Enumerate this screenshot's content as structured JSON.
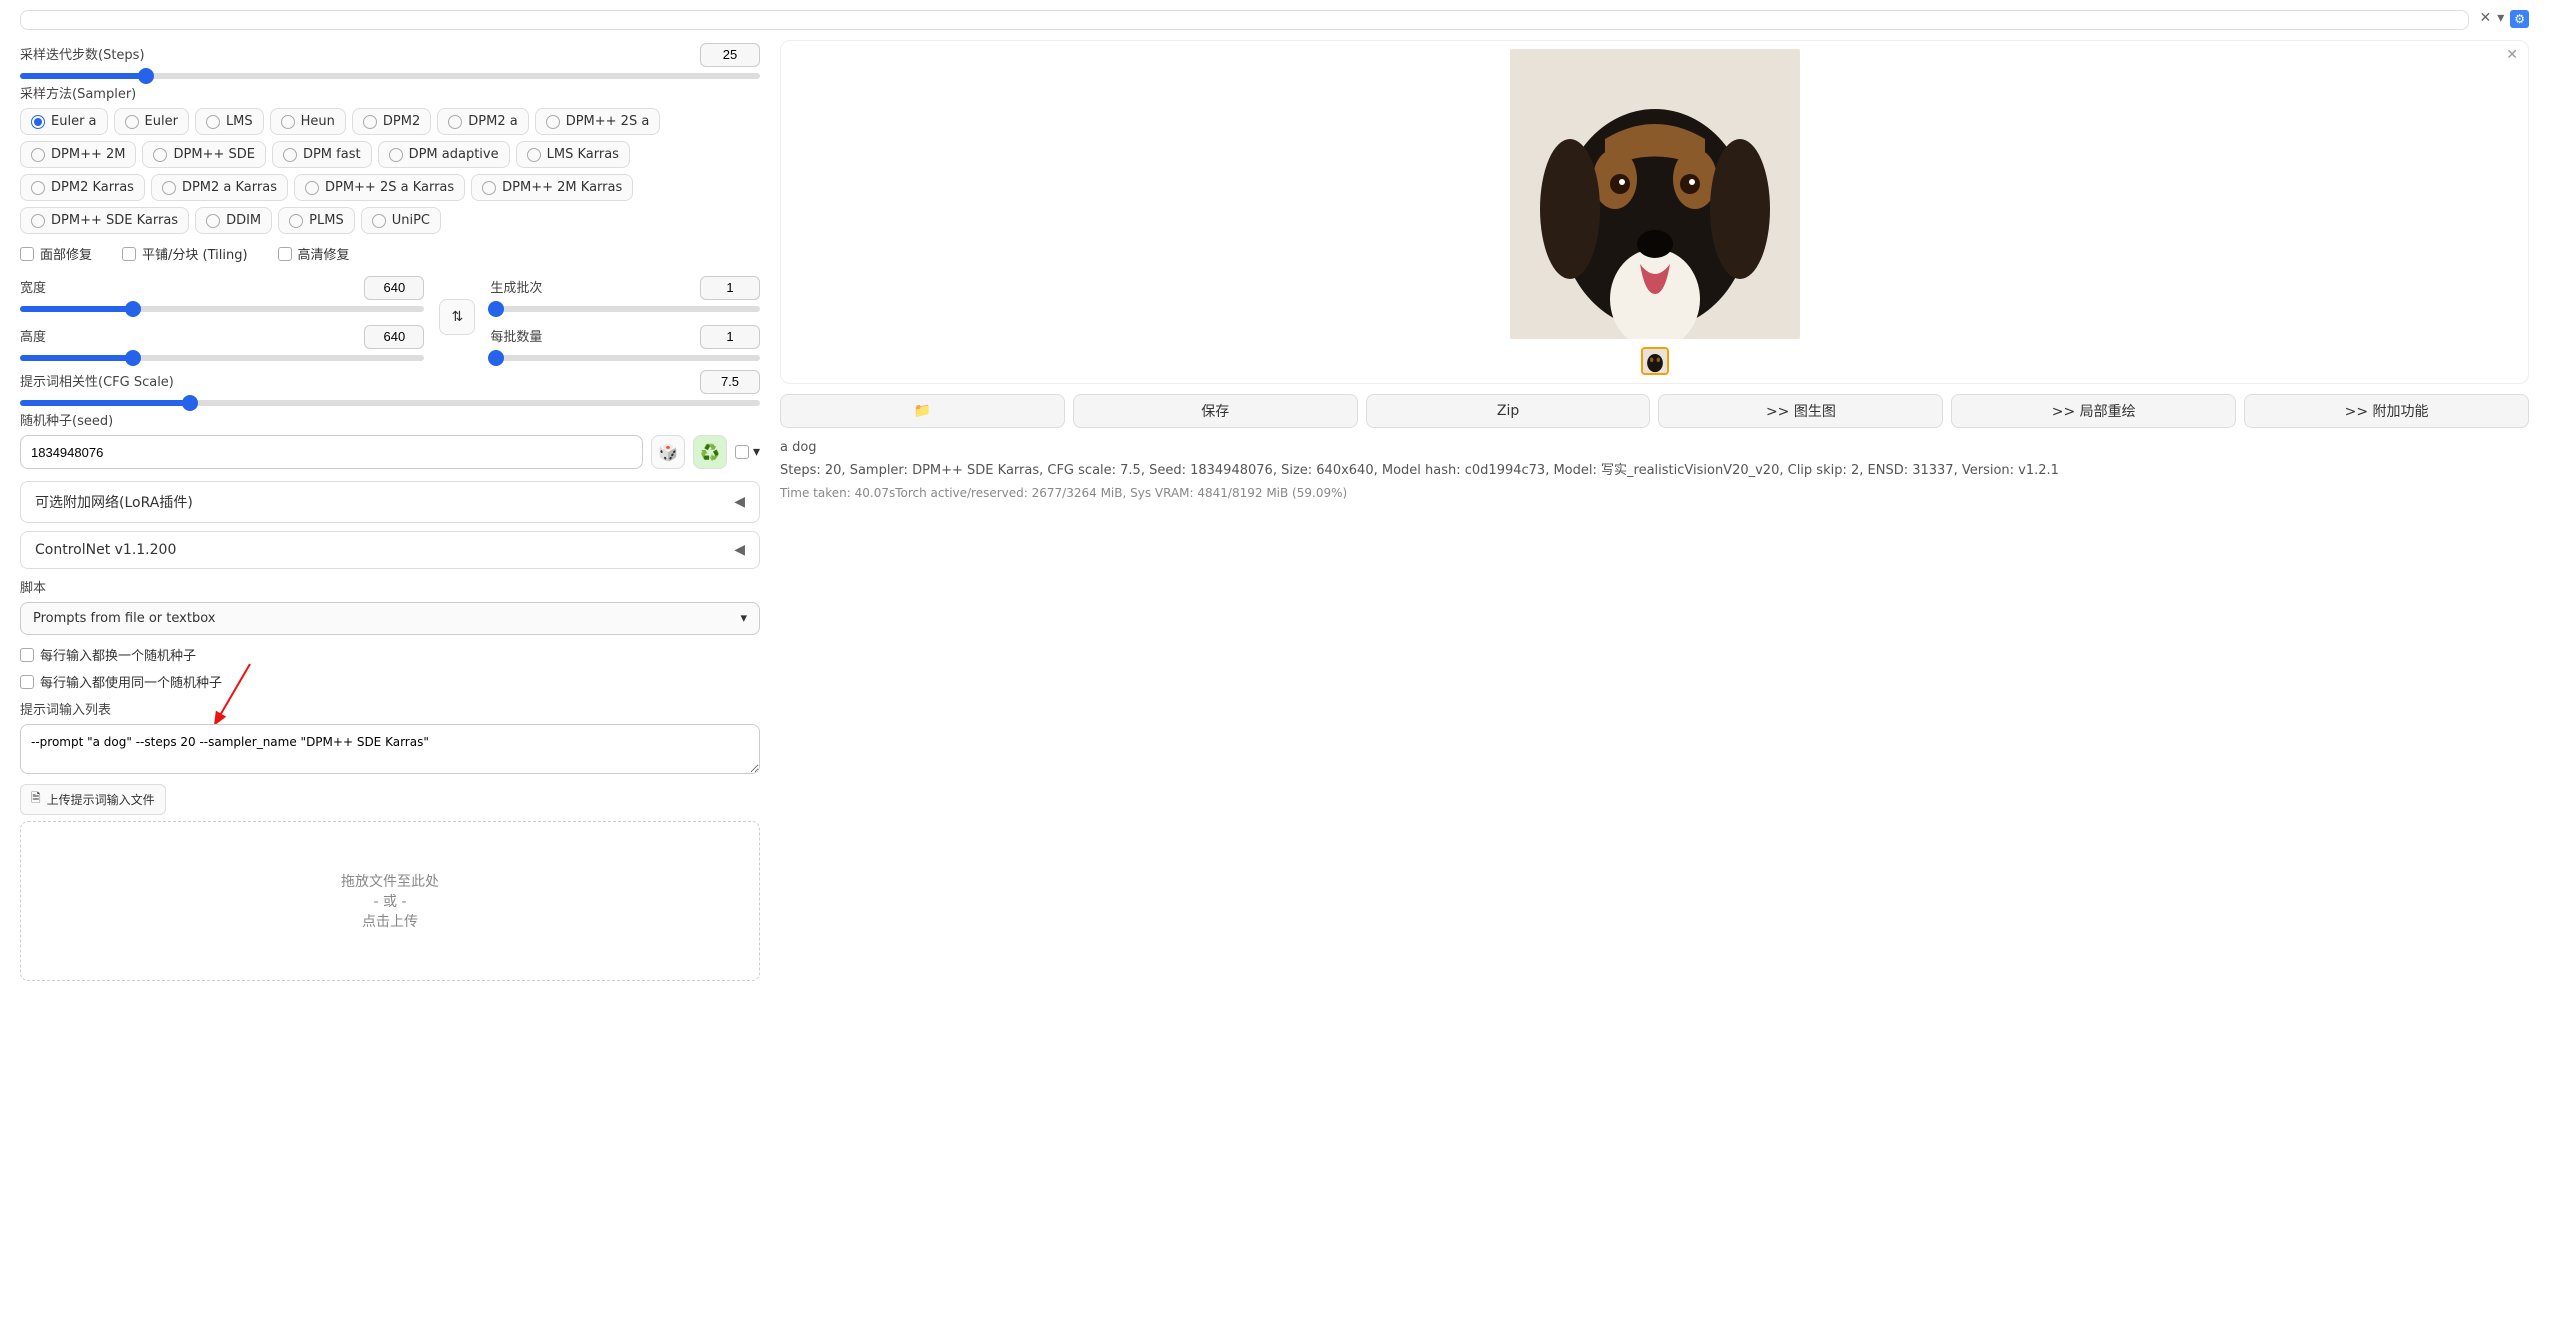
{
  "steps": {
    "label": "采样迭代步数(Steps)",
    "value": "25"
  },
  "sampler": {
    "label": "采样方法(Sampler)",
    "selected": "Euler a",
    "options": [
      "Euler a",
      "Euler",
      "LMS",
      "Heun",
      "DPM2",
      "DPM2 a",
      "DPM++ 2S a",
      "DPM++ 2M",
      "DPM++ SDE",
      "DPM fast",
      "DPM adaptive",
      "LMS Karras",
      "DPM2 Karras",
      "DPM2 a Karras",
      "DPM++ 2S a Karras",
      "DPM++ 2M Karras",
      "DPM++ SDE Karras",
      "DDIM",
      "PLMS",
      "UniPC"
    ]
  },
  "checkboxes": {
    "face": "面部修复",
    "tiling": "平铺/分块 (Tiling)",
    "hires": "高清修复"
  },
  "width": {
    "label": "宽度",
    "value": "640"
  },
  "height": {
    "label": "高度",
    "value": "640"
  },
  "batch_count": {
    "label": "生成批次",
    "value": "1"
  },
  "batch_size": {
    "label": "每批数量",
    "value": "1"
  },
  "cfg": {
    "label": "提示词相关性(CFG Scale)",
    "value": "7.5"
  },
  "seed": {
    "label": "随机种子(seed)",
    "value": "1834948076"
  },
  "accordion_lora": "可选附加网络(LoRA插件)",
  "accordion_controlnet": "ControlNet v1.1.200",
  "script": {
    "label": "脚本",
    "selected": "Prompts from file or textbox"
  },
  "script_opts": {
    "random_each": "每行输入都换一个随机种子",
    "same_seed": "每行输入都使用同一个随机种子",
    "prompt_list_label": "提示词输入列表",
    "prompt_list_value": "--prompt \"a dog\" --steps 20 --sampler_name \"DPM++ SDE Karras\"",
    "upload_btn": "上传提示词输入文件"
  },
  "dropzone": {
    "line1": "拖放文件至此处",
    "line2": "- 或 -",
    "line3": "点击上传"
  },
  "output": {
    "prompt": "a dog",
    "params": "Steps: 20, Sampler: DPM++ SDE Karras, CFG scale: 7.5, Seed: 1834948076, Size: 640x640, Model hash: c0d1994c73, Model: 写实_realisticVisionV20_v20, Clip skip: 2, ENSD: 31337, Version: v1.2.1",
    "time": "Time taken: 40.07sTorch active/reserved: 2677/3264 MiB, Sys VRAM: 4841/8192 MiB (59.09%)"
  },
  "buttons": {
    "folder": "📁",
    "save": "保存",
    "zip": "Zip",
    "img2img": ">> 图生图",
    "inpaint": ">> 局部重绘",
    "extras": ">> 附加功能"
  }
}
